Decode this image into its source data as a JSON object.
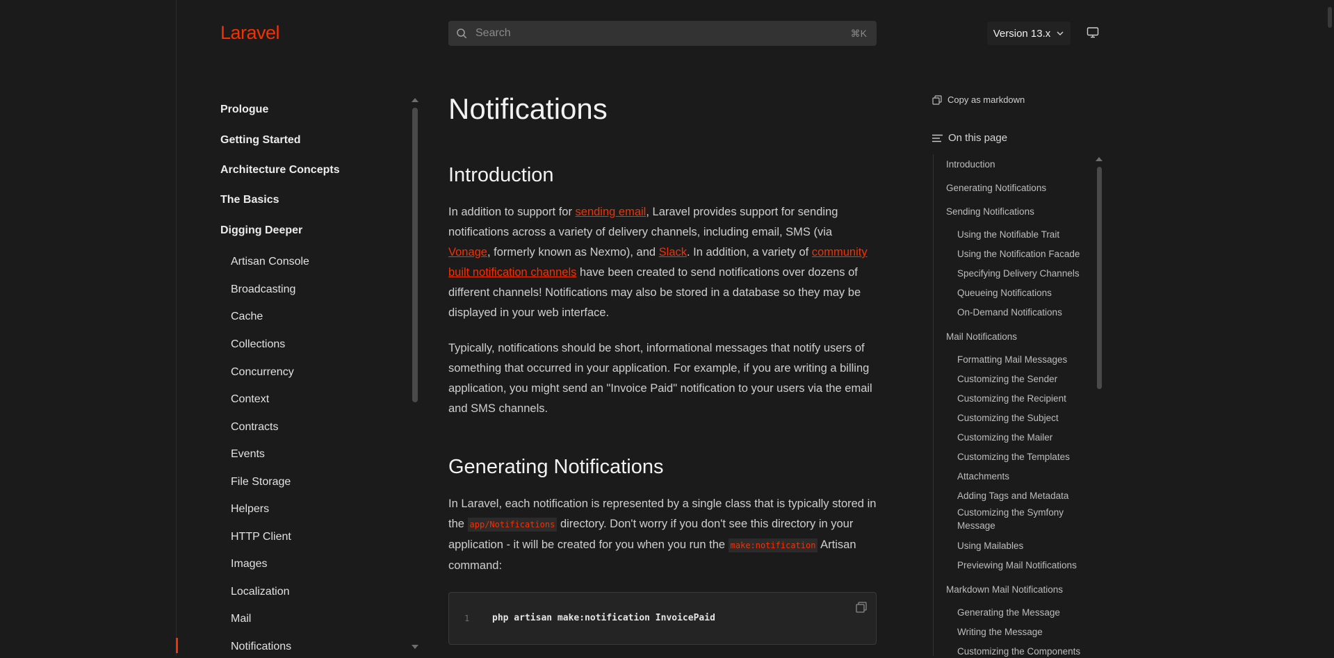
{
  "header": {
    "logo": "Laravel",
    "search_placeholder": "Search",
    "search_shortcut": "⌘K",
    "version_label": "Version 13.x"
  },
  "sidebar": {
    "sections": [
      "Prologue",
      "Getting Started",
      "Architecture Concepts",
      "The Basics",
      "Digging Deeper"
    ],
    "sub_items": [
      "Artisan Console",
      "Broadcasting",
      "Cache",
      "Collections",
      "Concurrency",
      "Context",
      "Contracts",
      "Events",
      "File Storage",
      "Helpers",
      "HTTP Client",
      "Images",
      "Localization",
      "Mail",
      "Notifications"
    ],
    "active_item": "Notifications"
  },
  "main": {
    "title": "Notifications",
    "intro_heading": "Introduction",
    "intro_p1": {
      "t1": "In addition to support for ",
      "link1": "sending email",
      "t2": ", Laravel provides support for sending notifications across a variety of delivery channels, including email, SMS (via ",
      "link2": "Vonage",
      "t3": ", formerly known as Nexmo), and ",
      "link3": "Slack",
      "t4": ". In addition, a variety of ",
      "link4": "community built notification channels",
      "t5": " have been created to send notifications over dozens of different channels! Notifications may also be stored in a database so they may be displayed in your web interface."
    },
    "intro_p2": "Typically, notifications should be short, informational messages that notify users of something that occurred in your application. For example, if you are writing a billing application, you might send an \"Invoice Paid\" notification to your users via the email and SMS channels.",
    "gen_heading": "Generating Notifications",
    "gen_p": {
      "t1": "In Laravel, each notification is represented by a single class that is typically stored in the ",
      "code1": "app/Notifications",
      "t2": " directory. Don't worry if you don't see this directory in your application - it will be created for you when you run the ",
      "code2": "make:notification",
      "t3": " Artisan command:"
    },
    "code_line_no": "1",
    "code_line": "php artisan make:notification InvoicePaid"
  },
  "toc": {
    "copy_markdown": "Copy as markdown",
    "on_this_page": "On this page",
    "items": [
      {
        "label": "Introduction",
        "level": 1
      },
      {
        "label": "Generating Notifications",
        "level": 1
      },
      {
        "label": "Sending Notifications",
        "level": 1
      },
      {
        "label": "Using the Notifiable Trait",
        "level": 2
      },
      {
        "label": "Using the Notification Facade",
        "level": 2
      },
      {
        "label": "Specifying Delivery Channels",
        "level": 2
      },
      {
        "label": "Queueing Notifications",
        "level": 2
      },
      {
        "label": "On-Demand Notifications",
        "level": 2
      },
      {
        "label": "Mail Notifications",
        "level": 1
      },
      {
        "label": "Formatting Mail Messages",
        "level": 2
      },
      {
        "label": "Customizing the Sender",
        "level": 2
      },
      {
        "label": "Customizing the Recipient",
        "level": 2
      },
      {
        "label": "Customizing the Subject",
        "level": 2
      },
      {
        "label": "Customizing the Mailer",
        "level": 2
      },
      {
        "label": "Customizing the Templates",
        "level": 2
      },
      {
        "label": "Attachments",
        "level": 2
      },
      {
        "label": "Adding Tags and Metadata",
        "level": 2
      },
      {
        "label": "Customizing the Symfony Message",
        "level": 2
      },
      {
        "label": "Using Mailables",
        "level": 2
      },
      {
        "label": "Previewing Mail Notifications",
        "level": 2
      },
      {
        "label": "Markdown Mail Notifications",
        "level": 1
      },
      {
        "label": "Generating the Message",
        "level": 2
      },
      {
        "label": "Writing the Message",
        "level": 2
      },
      {
        "label": "Customizing the Components",
        "level": 2
      }
    ]
  },
  "colors": {
    "accent": "#f53003",
    "background": "#1b1b1b",
    "search_bg": "#333333"
  },
  "icons": [
    "search-icon",
    "chevron-down-icon",
    "monitor-icon",
    "copy-icon",
    "list-icon"
  ]
}
